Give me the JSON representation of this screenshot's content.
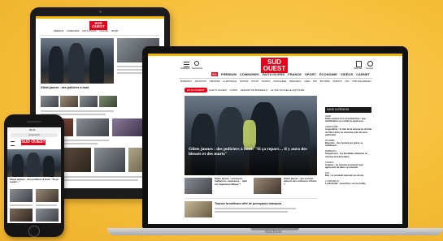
{
  "site": {
    "logo": "SUD OUEST",
    "brand_color": "#e3051b",
    "accent_color": "#f2b600"
  },
  "laptop": {
    "brand_label": "MacBook",
    "menu_label": "Rubriques",
    "search_label": "Rechercher",
    "right_icons": [
      "Abonnés",
      "Compte"
    ],
    "main_nav": [
      "PREMIUM",
      "COMMUNES",
      "FAITS DIVERS",
      "FRANCE",
      "SPORT",
      "ÉCONOMIE",
      "VIDÉOS",
      "CARNET"
    ],
    "premium_badge": "SO",
    "sub_nav": [
      "BORDEAUX",
      "ARCACHON",
      "LIBOURNE",
      "LA ROCHELLE",
      "SAINTES",
      "ROYAN",
      "COGNAC",
      "ANGOULÊME",
      "PÉRIGUEUX",
      "AGEN",
      "PAU",
      "BAYONNE",
      "BIARRITZ",
      "DAX",
      "MONT-DE-MARSAN"
    ],
    "live_button": "EN CE MOMENT",
    "live_tags": [
      "GILETS JAUNES",
      "COPPA",
      "DÉRIVES DE BORDEAUX",
      "LE SAP NOUVELLE-AQUITAINE"
    ],
    "headline": "Gilets jaunes : des policiers à bout. \"Si ça repart… il y aura des blessés et des morts\"",
    "sub_story_1": "Gilets jaunes : annonces, malfaçons, espérance… quel est l'agenda politique ?",
    "sub_story_2": "Gilets jaunes : qui sont les auteurs des violences à Paris ?",
    "bottom_story": "Trouvez la meilleure offre de prévoyance obsèques",
    "region_header": "DANS LA RÉGION",
    "region_items": [
      {
        "place": "AGEN",
        "text": "Gilets jaunes en Lot-et-Garonne : une mobilisation en retrait ce week-end"
      },
      {
        "place": "ANGOULÊME",
        "text": "Angoulême : le rôle de la cartouche de Eila de Vinci dans un incendie près de chez particulier"
      },
      {
        "place": "BAYONNE",
        "text": "Bayonne : des lycéens en grève se mobilisent"
      },
      {
        "place": "BORDEAUX",
        "text": "Suspension : les Bordelais attendus en nombre le 8 décembre"
      },
      {
        "place": "COGNAC",
        "text": "Cognac : un homme poursuivi pour agression de dans ce moment"
      },
      {
        "place": "DAX",
        "text": "Dax : le carnaval reprend ses droits"
      },
      {
        "place": "LA ROCHELLE",
        "text": "La Rochelle : bouchons sur la rocade"
      }
    ]
  },
  "tablet": {
    "nav": [
      "PREMIUM",
      "COMMUNES",
      "FAITS DIVERS",
      "FRANCE",
      "SPORT"
    ],
    "headline": "Gilets jaunes : des policiers à bout"
  },
  "phone": {
    "url": "sudouest.fr",
    "time": "09:41",
    "headline": "Gilets jaunes : des policiers à bout. \"Si ça repart…\""
  }
}
